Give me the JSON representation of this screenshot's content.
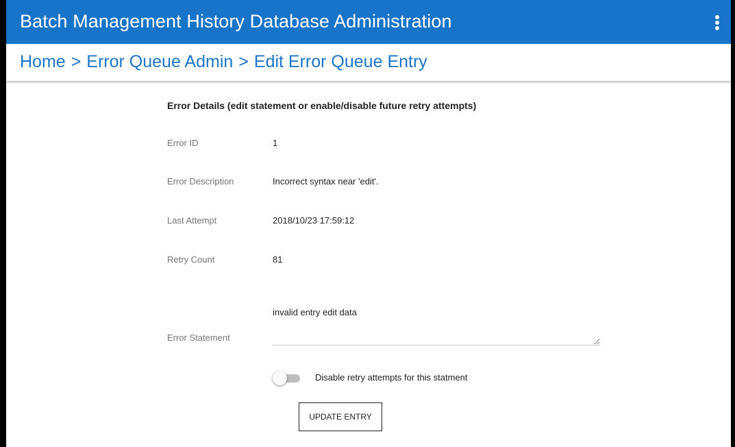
{
  "app": {
    "title": "Batch Management History Database Administration",
    "menu_icon": "more-vert-icon"
  },
  "breadcrumb": {
    "items": [
      "Home",
      "Error Queue Admin",
      "Edit Error Queue Entry"
    ],
    "separator": ">"
  },
  "details": {
    "heading": "Error Details (edit statement or enable/disable future retry attempts)",
    "fields": [
      {
        "label": "Error ID",
        "value": "1"
      },
      {
        "label": "Error Description",
        "value": "Incorrect syntax near 'edit'."
      },
      {
        "label": "Last Attempt",
        "value": "2018/10/23 17:59:12"
      },
      {
        "label": "Retry Count",
        "value": "81"
      }
    ],
    "statement": {
      "label": "Error Statement",
      "value": "invalid entry edit data"
    },
    "disable_retry": {
      "label": "Disable retry attempts for this statment",
      "checked": false
    },
    "update_button": "UPDATE ENTRY"
  },
  "colors": {
    "app_bar": "#1774c9",
    "breadcrumb_text": "#1c75c9"
  }
}
